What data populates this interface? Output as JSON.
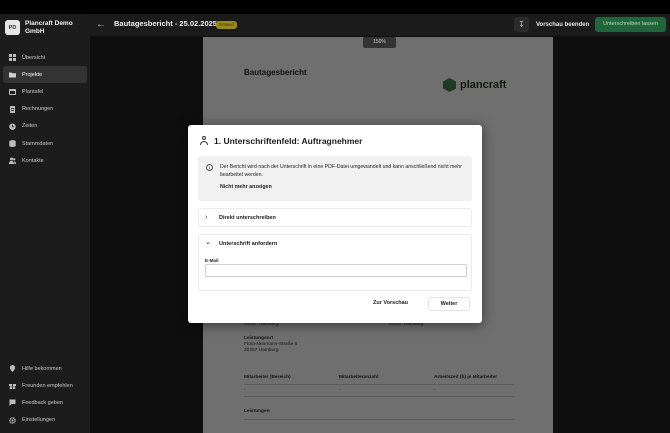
{
  "sidebar": {
    "org_initials": "PD",
    "org_name": "Plancraft Demo GmbH",
    "items": [
      {
        "label": "Übersicht",
        "icon": "grid-icon"
      },
      {
        "label": "Projekte",
        "icon": "folder-icon",
        "active": true
      },
      {
        "label": "Plantafel",
        "icon": "calendar-icon"
      },
      {
        "label": "Rechnungen",
        "icon": "invoice-icon"
      },
      {
        "label": "Zeiten",
        "icon": "clock-icon"
      },
      {
        "label": "Stammdaten",
        "icon": "database-icon"
      },
      {
        "label": "Kontakte",
        "icon": "contacts-icon"
      }
    ],
    "bottom_items": [
      {
        "label": "Hilfe bekommen",
        "icon": "help-icon"
      },
      {
        "label": "Freunden empfehlen",
        "icon": "gift-icon"
      },
      {
        "label": "Feedback geben",
        "icon": "feedback-icon"
      },
      {
        "label": "Einstellungen",
        "icon": "gear-icon"
      }
    ]
  },
  "header": {
    "title": "Bautagesbericht - 25.02.2025",
    "badge": "Entwurf",
    "preview_end": "Vorschau beenden",
    "sign_button": "Unterschreiben lassen"
  },
  "document": {
    "zoom": "150%",
    "title": "Bautagesbericht",
    "logo_text": "plancraft",
    "left_city": "20257 Hamburg",
    "right_city": "20257 Hamburg",
    "location_label": "Leistungsort",
    "location_street": "Flora-Neumann-Straße 6",
    "location_city": "20257 Hamburg",
    "table_headers": [
      "Mitarbeiter (Bereich)",
      "Mitarbeiteranzahl",
      "Arbeitszeit (h) je Mitarbeiter"
    ],
    "table_row": [
      "-",
      "-",
      "-"
    ],
    "section_services": "Leistungen"
  },
  "modal": {
    "title": "1. Unterschriftenfeld: Auftragnehmer",
    "info_text": "Der Bericht wird nach der Unterschrift in eine PDF-Datei umgewandelt und kann anschließend nicht mehr bearbeitet werden.",
    "info_link": "Nicht mehr anzeigen",
    "option_direct": "Direkt unterschreiben",
    "option_request": "Unterschrift anfordern",
    "email_label": "E-Mail",
    "email_value": "",
    "email_placeholder": "",
    "btn_preview": "Zur Vorschau",
    "btn_next": "Weiter"
  }
}
